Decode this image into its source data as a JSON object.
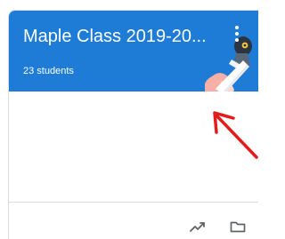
{
  "class_card": {
    "title": "Maple Class 2019-20...",
    "students": "23 students",
    "header_color": "#1e7bd6",
    "menu_icon": "more-vert-icon",
    "footer": {
      "icons": [
        "trending-up-icon",
        "folder-icon"
      ]
    }
  },
  "annotation": {
    "arrow_color": "#e31b1b"
  }
}
